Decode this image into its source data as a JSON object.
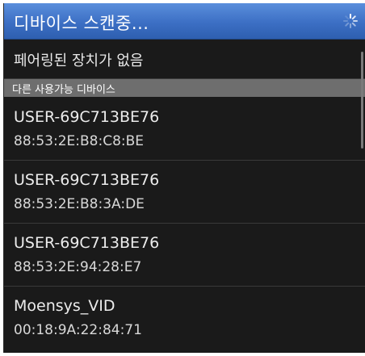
{
  "dialog": {
    "title": "디바이스 스캔중...",
    "spinner_icon": "loading-spinner-icon",
    "paired_empty_text": "페어링된 장치가 없음",
    "available_header": "다른 사용가능 디바이스",
    "devices": [
      {
        "name": "USER-69C713BE76",
        "address": "88:53:2E:B8:C8:BE"
      },
      {
        "name": "USER-69C713BE76",
        "address": "88:53:2E:B8:3A:DE"
      },
      {
        "name": "USER-69C713BE76",
        "address": "88:53:2E:94:28:E7"
      },
      {
        "name": "Moensys_VID",
        "address": "00:18:9A:22:84:71"
      }
    ]
  },
  "colors": {
    "title_bar": "#3c6fc4",
    "background": "#1a1a1a",
    "section_header": "#6e6e6e",
    "divider": "#3a3a3a"
  }
}
